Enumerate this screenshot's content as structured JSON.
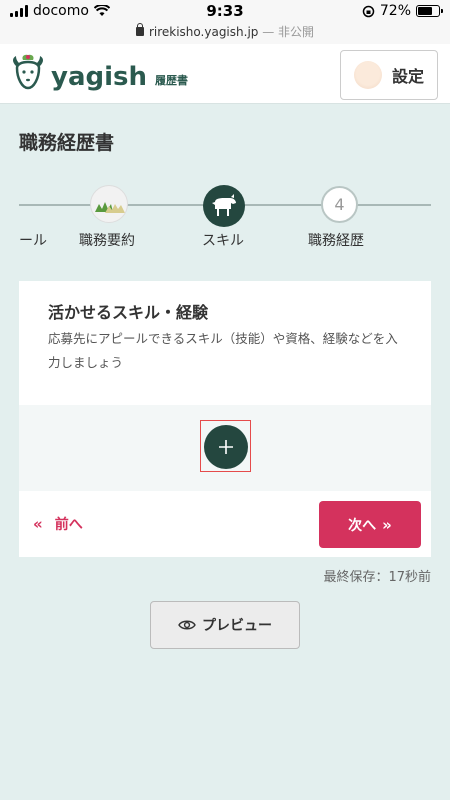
{
  "status_bar": {
    "carrier": "docomo",
    "time": "9:33",
    "battery": "72%",
    "battery_level": 0.72,
    "url": "rirekisho.yagish.jp",
    "url_suffix": "— 非公開"
  },
  "header": {
    "logo_text": "yagish",
    "logo_sub": "履歴書",
    "settings_label": "設定"
  },
  "page": {
    "title": "職務経歴書"
  },
  "stepper": {
    "steps": [
      {
        "label": "ール",
        "state": "done"
      },
      {
        "label": "職務要約",
        "state": "done"
      },
      {
        "label": "スキル",
        "state": "current"
      },
      {
        "label": "職務経歴",
        "state": "upcoming",
        "number": "4"
      }
    ]
  },
  "card": {
    "title": "活かせるスキル・経験",
    "description": "応募先にアピールできるスキル（技能）や資格、経験などを入力しましょう",
    "add_symbol": "+",
    "prev_label": "前へ",
    "next_label": "次へ"
  },
  "saved_text": "最終保存：17秒前",
  "preview_label": "プレビュー",
  "colors": {
    "accent": "#d4325d",
    "brand": "#24473f",
    "background": "#e3efee"
  }
}
